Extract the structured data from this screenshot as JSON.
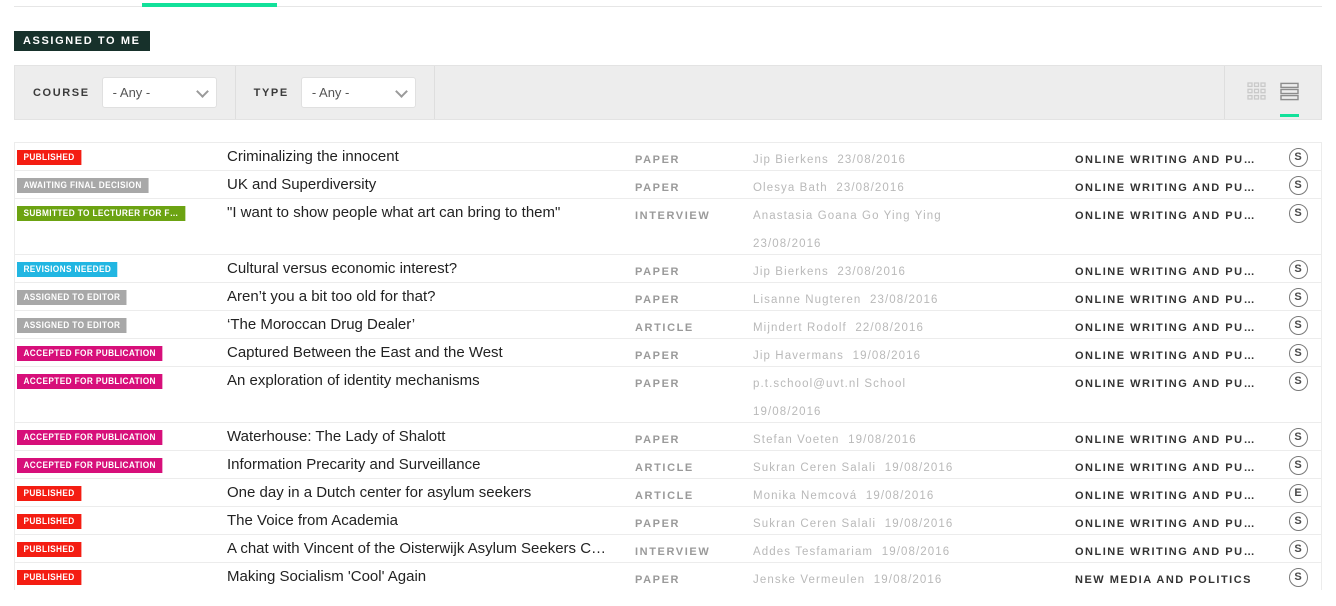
{
  "tabs": {
    "active_indicator_color": "#12e19a"
  },
  "section": {
    "badge_label": "ASSIGNED TO ME",
    "badge_bg": "#17312b"
  },
  "filters": {
    "course": {
      "label": "COURSE",
      "value": "- Any -",
      "chevron": "chevron-down-icon"
    },
    "type": {
      "label": "TYPE",
      "value": "- Any -",
      "chevron": "chevron-down-icon"
    },
    "view": {
      "grid_icon": "grid-view-icon",
      "list_icon": "list-view-icon",
      "active": "list"
    }
  },
  "status_colors": {
    "published": "#f41d12",
    "awaiting_final_decision": "#a8a8a8",
    "submitted_to_lecturer": "#6ca312",
    "revisions_needed": "#22b6e2",
    "assigned_to_editor": "#a8a8a8",
    "accepted_for_publication": "#d70f7a"
  },
  "table": {
    "rows": [
      {
        "status": "PUBLISHED",
        "status_key": "published",
        "title": "Criminalizing the innocent",
        "type": "PAPER",
        "author": "Jip Bierkens",
        "date": "23/08/2016",
        "course": "ONLINE WRITING AND PU…",
        "mark": "S",
        "two_line": false
      },
      {
        "status": "AWAITING FINAL DECISION",
        "status_key": "awaiting_final_decision",
        "title": "UK and Superdiversity",
        "type": "PAPER",
        "author": "Olesya Bath",
        "date": "23/08/2016",
        "course": "ONLINE WRITING AND PU…",
        "mark": "S",
        "two_line": false
      },
      {
        "status": "SUBMITTED TO LECTURER FOR F…",
        "status_key": "submitted_to_lecturer",
        "title": "\"I want to show people what art can bring to them\"",
        "type": "INTERVIEW",
        "author": "Anastasia Goana Go Ying Ying",
        "date": "23/08/2016",
        "course": "ONLINE WRITING AND PU…",
        "mark": "S",
        "two_line": true
      },
      {
        "status": "REVISIONS NEEDED",
        "status_key": "revisions_needed",
        "title": "Cultural versus economic interest?",
        "type": "PAPER",
        "author": "Jip Bierkens",
        "date": "23/08/2016",
        "course": "ONLINE WRITING AND PU…",
        "mark": "S",
        "two_line": false
      },
      {
        "status": "ASSIGNED TO EDITOR",
        "status_key": "assigned_to_editor",
        "title": "Aren’t you a bit too old for that?",
        "type": "PAPER",
        "author": "Lisanne Nugteren",
        "date": "23/08/2016",
        "course": "ONLINE WRITING AND PU…",
        "mark": "S",
        "two_line": false
      },
      {
        "status": "ASSIGNED TO EDITOR",
        "status_key": "assigned_to_editor",
        "title": "‘The Moroccan Drug Dealer’",
        "type": "ARTICLE",
        "author": "Mijndert Rodolf",
        "date": "22/08/2016",
        "course": "ONLINE WRITING AND PU…",
        "mark": "S",
        "two_line": false
      },
      {
        "status": "ACCEPTED FOR PUBLICATION",
        "status_key": "accepted_for_publication",
        "title": "Captured Between the East and the West",
        "type": "PAPER",
        "author": "Jip Havermans",
        "date": "19/08/2016",
        "course": "ONLINE WRITING AND PU…",
        "mark": "S",
        "two_line": false
      },
      {
        "status": "ACCEPTED FOR PUBLICATION",
        "status_key": "accepted_for_publication",
        "title": "An exploration of identity mechanisms",
        "type": "PAPER",
        "author": "p.t.school@uvt.nl School",
        "date": "19/08/2016",
        "course": "ONLINE WRITING AND PU…",
        "mark": "S",
        "two_line": true
      },
      {
        "status": "ACCEPTED FOR PUBLICATION",
        "status_key": "accepted_for_publication",
        "title": "Waterhouse: The Lady of Shalott",
        "type": "PAPER",
        "author": "Stefan Voeten",
        "date": "19/08/2016",
        "course": "ONLINE WRITING AND PU…",
        "mark": "S",
        "two_line": false
      },
      {
        "status": "ACCEPTED FOR PUBLICATION",
        "status_key": "accepted_for_publication",
        "title": "Information Precarity and Surveillance",
        "type": "ARTICLE",
        "author": "Sukran Ceren Salali",
        "date": "19/08/2016",
        "course": "ONLINE WRITING AND PU…",
        "mark": "S",
        "two_line": false
      },
      {
        "status": "PUBLISHED",
        "status_key": "published",
        "title": "One day in a Dutch center for asylum seekers",
        "type": "ARTICLE",
        "author": "Monika Nemcová",
        "date": "19/08/2016",
        "course": "ONLINE WRITING AND PU…",
        "mark": "E",
        "two_line": false
      },
      {
        "status": "PUBLISHED",
        "status_key": "published",
        "title": "The Voice from Academia",
        "type": "PAPER",
        "author": "Sukran Ceren Salali",
        "date": "19/08/2016",
        "course": "ONLINE WRITING AND PU…",
        "mark": "S",
        "two_line": false
      },
      {
        "status": "PUBLISHED",
        "status_key": "published",
        "title": "A chat with Vincent of the Oisterwijk Asylum Seekers C…",
        "type": "INTERVIEW",
        "author": "Addes Tesfamariam",
        "date": "19/08/2016",
        "course": "ONLINE WRITING AND PU…",
        "mark": "S",
        "two_line": false
      },
      {
        "status": "PUBLISHED",
        "status_key": "published",
        "title": "Making Socialism 'Cool' Again",
        "type": "PAPER",
        "author": "Jenske Vermeulen",
        "date": "19/08/2016",
        "course": "NEW MEDIA AND POLITICS",
        "mark": "S",
        "two_line": false
      }
    ]
  }
}
